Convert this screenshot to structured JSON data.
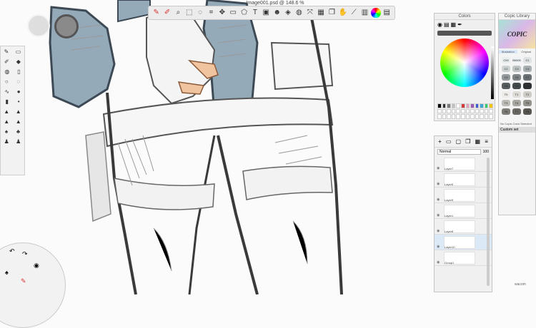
{
  "window": {
    "title": "Image001.psd @ 148.6 %"
  },
  "toolbar": {
    "tools": [
      {
        "name": "brush-library-icon",
        "glyph": "✎"
      },
      {
        "name": "brush-icon",
        "glyph": "✐"
      },
      {
        "name": "zoom-icon",
        "glyph": "⌕"
      },
      {
        "name": "select-icon",
        "glyph": "⬚"
      },
      {
        "name": "lasso-icon",
        "glyph": "◌"
      },
      {
        "name": "crop-icon",
        "glyph": "⌗"
      },
      {
        "name": "transform-icon",
        "glyph": "✥"
      },
      {
        "name": "shape-icon",
        "glyph": "▭"
      },
      {
        "name": "perspective-icon",
        "glyph": "⬠"
      },
      {
        "name": "text-icon",
        "glyph": "T"
      },
      {
        "name": "image-icon",
        "glyph": "▣"
      },
      {
        "name": "symmetry-icon",
        "glyph": "☻"
      },
      {
        "name": "flipbook-icon",
        "glyph": "◈"
      },
      {
        "name": "fill-icon",
        "glyph": "◍"
      },
      {
        "name": "distort-icon",
        "glyph": "⤧"
      },
      {
        "name": "ruler-icon",
        "glyph": "▦"
      },
      {
        "name": "layers-icon",
        "glyph": "❐"
      },
      {
        "name": "hand-icon",
        "glyph": "✋"
      },
      {
        "name": "stroke-icon",
        "glyph": "⟋"
      },
      {
        "name": "copic-icon",
        "glyph": "▥"
      },
      {
        "name": "color-wheel-icon",
        "glyph": ""
      },
      {
        "name": "grid-icon",
        "glyph": "▤"
      }
    ]
  },
  "colors_panel": {
    "title": "Colors",
    "swatch_colors": [
      "#000000",
      "#333333",
      "#7a7a7a",
      "#bfbfbf",
      "#ffffff",
      "#d23b3b",
      "#e6a1c1",
      "#9b59b6",
      "#3b5bd2",
      "#3ba7d2",
      "#2ecc71",
      "#f1c40f",
      "#ffffff",
      "#ffffff",
      "#ffffff",
      "#ffffff",
      "#ffffff",
      "#ffffff",
      "#ffffff",
      "#ffffff",
      "#ffffff",
      "#ffffff",
      "#ffffff",
      "#ffffff",
      "#ffffff",
      "#ffffff",
      "#ffffff",
      "#ffffff",
      "#ffffff",
      "#ffffff",
      "#ffffff",
      "#ffffff",
      "#ffffff",
      "#ffffff",
      "#ffffff",
      "#ffffff"
    ]
  },
  "copic_panel": {
    "title": "Copic Library",
    "logo": "COPIC",
    "tabs": [
      "Illustration",
      "Original"
    ],
    "colors": [
      {
        "code": "C00",
        "hex": "#e9eeee"
      },
      {
        "code": "B0000",
        "hex": "#eef3f6"
      },
      {
        "code": "C1",
        "hex": "#dfe3e3"
      },
      {
        "code": "C2",
        "hex": "#cdd2d3"
      },
      {
        "code": "C3",
        "hex": "#bfc4c5"
      },
      {
        "code": "C4",
        "hex": "#a9afb1"
      },
      {
        "code": "C5",
        "hex": "#949a9c"
      },
      {
        "code": "C6",
        "hex": "#7f8587"
      },
      {
        "code": "C7",
        "hex": "#6b7173"
      },
      {
        "code": "C8",
        "hex": "#585d5f"
      },
      {
        "code": "C9",
        "hex": "#454a4c"
      },
      {
        "code": "C10",
        "hex": "#2f3234"
      },
      {
        "code": "T0",
        "hex": "#eeece8"
      },
      {
        "code": "T1",
        "hex": "#dfddd8"
      },
      {
        "code": "T2",
        "hex": "#cfcdc8"
      },
      {
        "code": "T3",
        "hex": "#bebcb7"
      },
      {
        "code": "T4",
        "hex": "#a9a7a2"
      },
      {
        "code": "T5",
        "hex": "#94928d"
      },
      {
        "code": "T6",
        "hex": "#7f7d78"
      },
      {
        "code": "T7",
        "hex": "#6b6964"
      },
      {
        "code": "T8",
        "hex": "#585651"
      }
    ],
    "note": "No Copic Color Selected",
    "set_label": "Custom set"
  },
  "layers_panel": {
    "blend_mode": "Normal",
    "opacity_label": "100",
    "layers": [
      {
        "name": "Layer7",
        "selected": false
      },
      {
        "name": "Layer5",
        "selected": false
      },
      {
        "name": "Layer9",
        "selected": false
      },
      {
        "name": "Layer1",
        "selected": false
      },
      {
        "name": "Layer8",
        "selected": false
      },
      {
        "name": "Layer10",
        "selected": true
      },
      {
        "name": "Group1",
        "selected": false
      }
    ]
  },
  "footer": {
    "brand": "wacom"
  }
}
